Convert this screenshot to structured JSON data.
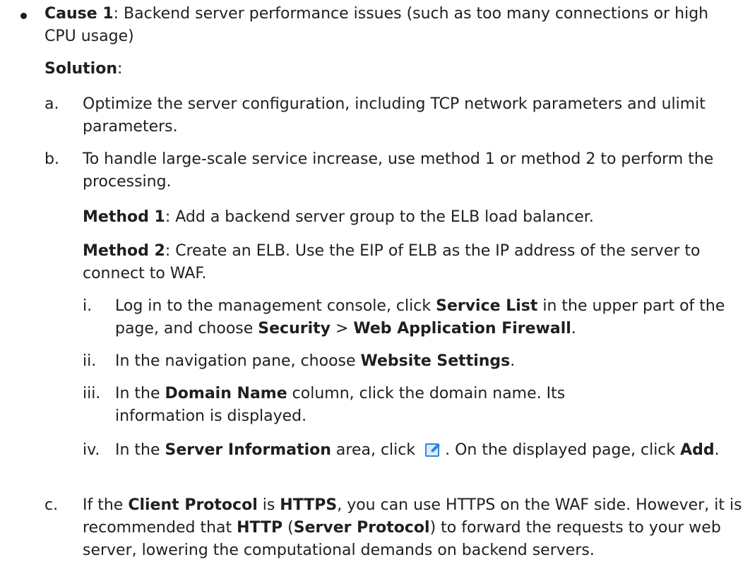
{
  "cause": {
    "label": "Cause 1",
    "text": ": Backend server performance issues (such as too many connections or high CPU usage)"
  },
  "solution": {
    "label": "Solution",
    "suffix": ":"
  },
  "steps": {
    "a": {
      "marker": "a.",
      "text": "Optimize the server configuration, including TCP network parameters and ulimit parameters."
    },
    "b": {
      "marker": "b.",
      "text": "To handle large-scale service increase, use method 1 or method 2 to perform the processing.",
      "method1": {
        "label": "Method 1",
        "text": ": Add a backend server group to the ELB load balancer."
      },
      "method2": {
        "label": "Method 2",
        "text": ": Create an ELB. Use the EIP of ELB as the IP address of the server to connect to WAF."
      },
      "sub": {
        "i": {
          "marker": "i.",
          "p1": "Log in to the management console, click ",
          "b1": "Service List",
          "p2": " in the upper part of the page, and choose ",
          "b2": "Security",
          "p3": " > ",
          "b3": "Web Application Firewall",
          "p4": "."
        },
        "ii": {
          "marker": "ii.",
          "p1": "In the navigation pane, choose ",
          "b1": "Website Settings",
          "p2": "."
        },
        "iii": {
          "marker": "iii.",
          "p1": "In the ",
          "b1": "Domain Name",
          "p2": " column, click the domain name. Its information is displayed."
        },
        "iv": {
          "marker": "iv.",
          "p1": "In the ",
          "b1": "Server Information",
          "p2": " area, click",
          "icon": "edit-icon",
          "p3": ". On the displayed page, click ",
          "b2": "Add",
          "p4": "."
        }
      }
    },
    "c": {
      "marker": "c.",
      "p1": "If the ",
      "b1": "Client Protocol",
      "p2": " is ",
      "b2": "HTTPS",
      "p3": ", you can use HTTPS on the WAF side. However, it is recommended that ",
      "b3": "HTTP",
      "p4": " (",
      "b4": "Server Protocol",
      "p5": ") to forward the requests to your web server, lowering the computational demands on backend servers."
    }
  },
  "colors": {
    "text": "#1f1f1f",
    "icon_blue": "#2f86d6",
    "icon_light": "#dcecf9"
  }
}
